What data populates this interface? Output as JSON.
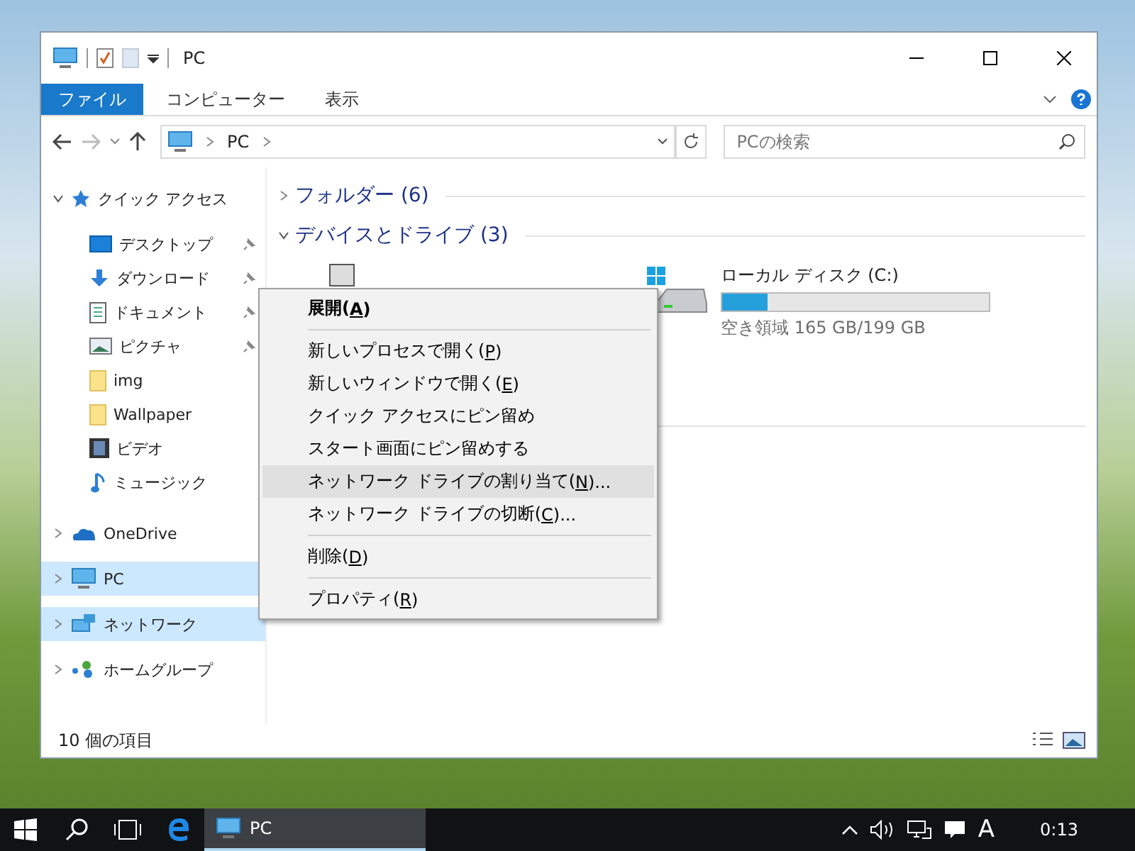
{
  "window": {
    "title": "PC"
  },
  "ribbon_tabs": [
    {
      "label": "ファイル",
      "selected": true
    },
    {
      "label": "コンピューター",
      "selected": false
    },
    {
      "label": "表示",
      "selected": false
    }
  ],
  "address": {
    "path": "PC"
  },
  "search": {
    "placeholder": "PCの検索"
  },
  "sidebar": {
    "items": [
      {
        "label": "クイック アクセス",
        "kind": "star",
        "expanded": true,
        "selected": false,
        "children": [
          {
            "label": "デスクトップ",
            "kind": "desktop",
            "pinned": true
          },
          {
            "label": "ダウンロード",
            "kind": "download",
            "pinned": true
          },
          {
            "label": "ドキュメント",
            "kind": "document",
            "pinned": true
          },
          {
            "label": "ピクチャ",
            "kind": "picture",
            "pinned": true
          },
          {
            "label": "img",
            "kind": "folder",
            "pinned": false
          },
          {
            "label": "Wallpaper",
            "kind": "folder",
            "pinned": false
          },
          {
            "label": "ビデオ",
            "kind": "video",
            "pinned": false
          },
          {
            "label": "ミュージック",
            "kind": "music",
            "pinned": false
          }
        ]
      },
      {
        "label": "OneDrive",
        "kind": "cloud",
        "expanded": false,
        "selected": false
      },
      {
        "label": "PC",
        "kind": "pc",
        "expanded": false,
        "selected": true
      },
      {
        "label": "ネットワーク",
        "kind": "network",
        "expanded": false,
        "selected": true
      },
      {
        "label": "ホームグループ",
        "kind": "homegroup",
        "expanded": false,
        "selected": false
      }
    ]
  },
  "groups": [
    {
      "label": "フォルダー (6)",
      "expanded": false
    },
    {
      "label": "デバイスとドライブ (3)",
      "expanded": true,
      "drives": [
        {
          "kind": "removable"
        },
        {
          "kind": "system",
          "name": "ローカル ディスク (C:)",
          "level": 0.17,
          "free": "空き領域 165 GB/199 GB"
        }
      ]
    }
  ],
  "context_menu": {
    "items": [
      {
        "kind": "item",
        "before": "展開(",
        "key": "A",
        "after": ")",
        "default": true,
        "selected": false
      },
      {
        "kind": "separator"
      },
      {
        "kind": "item",
        "before": "新しいプロセスで開く(",
        "key": "P",
        "after": ")",
        "default": false,
        "selected": false
      },
      {
        "kind": "item",
        "before": "新しいウィンドウで開く(",
        "key": "E",
        "after": ")",
        "default": false,
        "selected": false
      },
      {
        "kind": "item",
        "before": "クイック アクセスにピン留め",
        "default": false,
        "selected": false
      },
      {
        "kind": "item",
        "before": "スタート画面にピン留めする",
        "default": false,
        "selected": false
      },
      {
        "kind": "item",
        "before": "ネットワーク ドライブの割り当て(",
        "key": "N",
        "after": ")...",
        "default": false,
        "selected": true
      },
      {
        "kind": "item",
        "before": "ネットワーク ドライブの切断(",
        "key": "C",
        "after": ")...",
        "default": false,
        "selected": false
      },
      {
        "kind": "separator"
      },
      {
        "kind": "item",
        "before": "削除(",
        "key": "D",
        "after": ")",
        "default": false,
        "selected": false
      },
      {
        "kind": "separator"
      },
      {
        "kind": "item",
        "before": "プロパティ(",
        "key": "R",
        "after": ")",
        "default": false,
        "selected": false
      }
    ]
  },
  "status_bar": {
    "count": "10 個の項目"
  },
  "taskbar": {
    "apps": [
      {
        "label": "PC",
        "active": true
      }
    ],
    "ime": "A",
    "clock": "0:13"
  }
}
